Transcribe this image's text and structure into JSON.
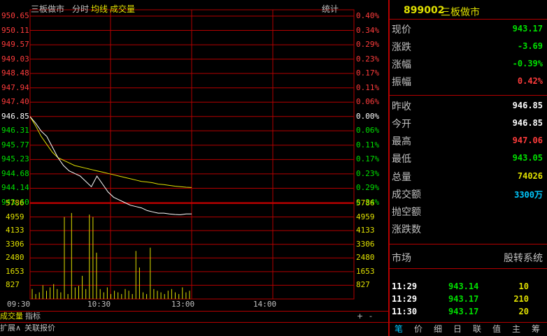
{
  "colors": {
    "up": "#ff3c3c",
    "down": "#00e000",
    "neutral": "#ffffff",
    "yellow": "#e0e000",
    "cyan": "#00c8ff",
    "grid": "#b40000"
  },
  "header": {
    "title": "三板做市",
    "tab_fenshi": "分时",
    "tab_junxian": "均线",
    "tab_volume": "成交量",
    "stats": "统计"
  },
  "price_ticks": [
    "950.65",
    "950.11",
    "949.57",
    "949.03",
    "948.48",
    "947.94",
    "947.40",
    "946.85",
    "946.31",
    "945.77",
    "945.23",
    "944.68",
    "944.14",
    "943.60"
  ],
  "pct_ticks": [
    "0.40%",
    "0.34%",
    "0.29%",
    "0.23%",
    "0.17%",
    "0.11%",
    "0.06%",
    "0.00%",
    "0.06%",
    "0.11%",
    "0.17%",
    "0.23%",
    "0.29%",
    "0.34%"
  ],
  "volume_ticks": [
    "5786",
    "4959",
    "4133",
    "3306",
    "2480",
    "1653",
    "827"
  ],
  "time_labels": [
    "09:30",
    "10:30",
    "13:00",
    "14:00"
  ],
  "chart_data": {
    "type": "line",
    "x_label": "",
    "prev_close": 946.85,
    "ylim": [
      943.05,
      950.65
    ],
    "price_series": [
      946.85,
      946.6,
      946.3,
      946.1,
      945.7,
      945.3,
      945.0,
      944.8,
      944.7,
      944.6,
      944.4,
      944.2,
      944.6,
      944.3,
      944.0,
      943.8,
      943.7,
      943.6,
      943.5,
      943.45,
      943.4,
      943.3,
      943.25,
      943.2,
      943.2,
      943.17,
      943.15,
      943.14,
      943.17,
      943.17
    ],
    "avg_series": [
      946.85,
      946.5,
      946.1,
      945.8,
      945.5,
      945.3,
      945.2,
      945.1,
      945.0,
      944.95,
      944.9,
      944.85,
      944.8,
      944.75,
      944.7,
      944.65,
      944.6,
      944.55,
      944.5,
      944.45,
      944.4,
      944.38,
      944.35,
      944.3,
      944.28,
      944.25,
      944.22,
      944.2,
      944.18,
      944.17
    ],
    "volume_max": 5786,
    "volume_series": [
      600,
      300,
      400,
      827,
      500,
      700,
      900,
      600,
      400,
      4959,
      300,
      5200,
      700,
      800,
      1400,
      600,
      5100,
      4959,
      2800,
      600,
      400,
      700,
      300,
      500,
      400,
      300,
      600,
      500,
      300,
      2900,
      1900,
      400,
      300,
      3100,
      600,
      500,
      400,
      300,
      500,
      600,
      400,
      300,
      700,
      400,
      500
    ]
  },
  "bottom_tabs": {
    "volume": "成交量",
    "indicator": "指标",
    "expand": "扩展∧",
    "related": "关联报价",
    "plus": "+",
    "minus": "-"
  },
  "quote": {
    "code": "899002",
    "name": "三板做市",
    "rows": [
      {
        "label": "现价",
        "value": "943.17",
        "color": "down"
      },
      {
        "label": "涨跌",
        "value": "-3.69",
        "color": "down"
      },
      {
        "label": "涨幅",
        "value": "-0.39%",
        "color": "down"
      },
      {
        "label": "振幅",
        "value": "0.42%",
        "color": "up"
      },
      {
        "label": "昨收",
        "value": "946.85",
        "color": "neutral"
      },
      {
        "label": "今开",
        "value": "946.85",
        "color": "neutral"
      },
      {
        "label": "最高",
        "value": "947.06",
        "color": "up"
      },
      {
        "label": "最低",
        "value": "943.05",
        "color": "down"
      },
      {
        "label": "总量",
        "value": "74026",
        "color": "yellow"
      },
      {
        "label": "成交额",
        "value": "3300万",
        "color": "cyan"
      },
      {
        "label": "抛空额",
        "value": "",
        "color": "neutral"
      },
      {
        "label": "涨跌数",
        "value": "",
        "color": "neutral"
      }
    ],
    "market_label": "市场",
    "market_value": "股转系统",
    "trades": [
      {
        "time": "11:29",
        "price": "943.14",
        "vol": "10"
      },
      {
        "time": "11:29",
        "price": "943.17",
        "vol": "210"
      },
      {
        "time": "11:30",
        "price": "943.17",
        "vol": "20"
      }
    ],
    "tabs": [
      "笔",
      "价",
      "细",
      "日",
      "联",
      "值",
      "主",
      "筹"
    ]
  }
}
